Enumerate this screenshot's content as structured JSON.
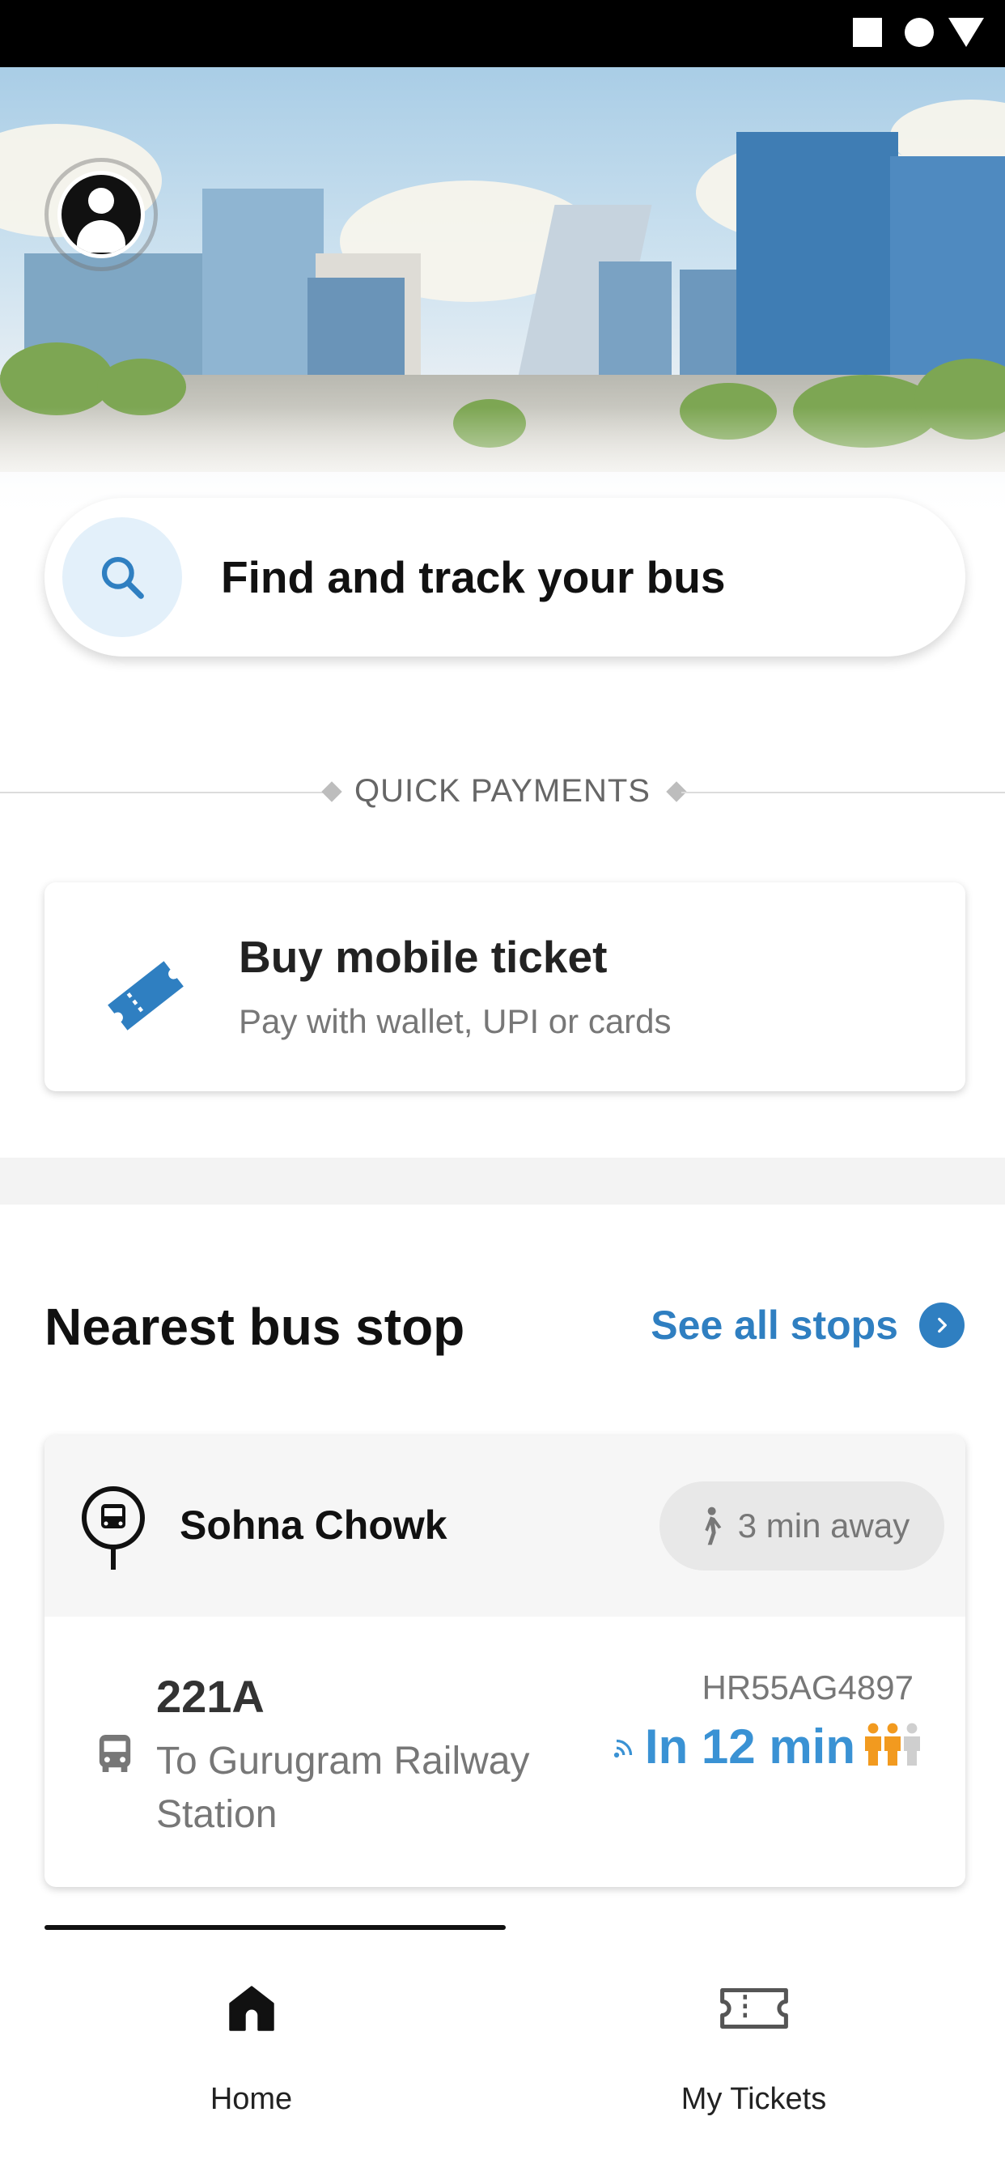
{
  "status_bar": {
    "icons": [
      "square-icon",
      "circle-icon",
      "triangle-icon"
    ]
  },
  "search": {
    "label": "Find and track your bus"
  },
  "quick_payments": {
    "label": "QUICK PAYMENTS"
  },
  "ticket_card": {
    "title": "Buy mobile ticket",
    "subtitle": "Pay with wallet, UPI or cards"
  },
  "nearest": {
    "title": "Nearest bus stop",
    "see_all": "See all stops",
    "stop": {
      "name": "Sohna Chowk",
      "walk_time": "3 min away",
      "route": {
        "number": "221A",
        "destination": "To Gurugram Railway Station",
        "plate": "HR55AG4897",
        "eta": "In 12 min",
        "occupancy_level": 2,
        "occupancy_max": 3
      }
    }
  },
  "bottom_nav": {
    "home": "Home",
    "tickets": "My Tickets"
  },
  "colors": {
    "accent": "#2f7fc1",
    "eta": "#3a92d4",
    "occupancy": "#f29a1f"
  }
}
